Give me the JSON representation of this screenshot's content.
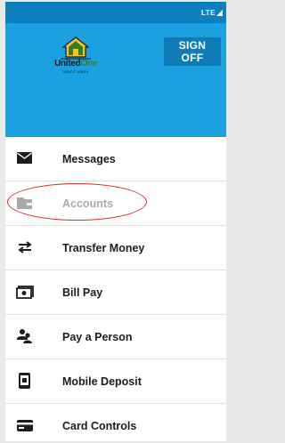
{
  "status_bar": {
    "network": "LTE"
  },
  "header": {
    "logo": {
      "name": "UnitedOne",
      "name_part1": "United",
      "name_part2": "One",
      "tagline": "CREDIT UNION"
    },
    "sign_off_label": "SIGN OFF"
  },
  "menu": {
    "items": [
      {
        "label": "Messages",
        "icon": "envelope-icon",
        "enabled": true
      },
      {
        "label": "Accounts",
        "icon": "folder-icon",
        "enabled": false
      },
      {
        "label": "Transfer Money",
        "icon": "transfer-arrows-icon",
        "enabled": true
      },
      {
        "label": "Bill Pay",
        "icon": "bill-pay-icon",
        "enabled": true
      },
      {
        "label": "Pay a Person",
        "icon": "people-icon",
        "enabled": true
      },
      {
        "label": "Mobile Deposit",
        "icon": "mobile-deposit-icon",
        "enabled": true
      },
      {
        "label": "Card Controls",
        "icon": "credit-card-icon",
        "enabled": true
      }
    ]
  },
  "annotation": {
    "highlighted_item": "Pay a Person",
    "color": "#c83232"
  },
  "colors": {
    "header": "#1ba0e0",
    "status_bar": "#0d7fbd",
    "button": "#0f7cb8"
  }
}
